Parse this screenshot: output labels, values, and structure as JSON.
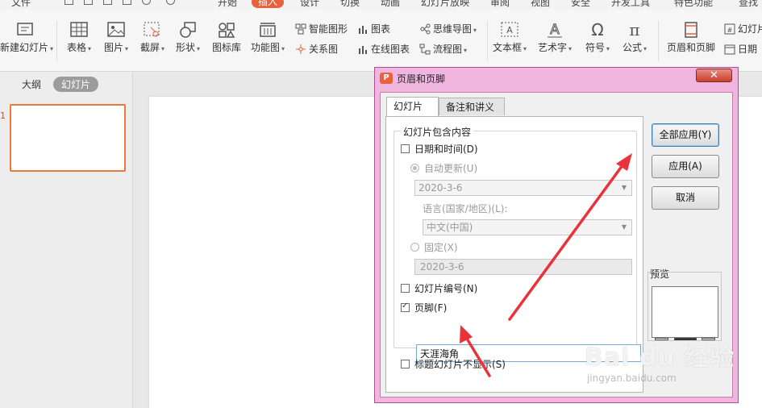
{
  "menubar": {
    "items": [
      "文件",
      "开始",
      "插入",
      "设计",
      "切换",
      "动画",
      "幻灯片放映",
      "审阅",
      "视图",
      "安全",
      "开发工具",
      "特色功能",
      "查找"
    ],
    "active": "插入"
  },
  "ribbon": {
    "new_slide": "新建幻灯片",
    "table": "表格",
    "picture": "图片",
    "screenshot": "截屏",
    "shape": "形状",
    "icon_lib": "图标库",
    "func_chart": "功能图",
    "smart_art": "智能图形",
    "relation": "关系图",
    "chart": "图表",
    "online_chart": "在线图表",
    "mind_map": "思维导图",
    "flow_chart": "流程图",
    "textbox": "文本框",
    "art_text": "艺术字",
    "symbol": "符号",
    "formula": "公式",
    "header_footer": "页眉和页脚",
    "slide_num": "幻灯片",
    "date": "日期"
  },
  "leftpanel": {
    "tab_outline": "大纲",
    "tab_slides": "幻灯片",
    "slide_number": "1"
  },
  "dialog": {
    "title": "页眉和页脚",
    "close": "✕",
    "tabs": [
      "幻灯片",
      "备注和讲义"
    ],
    "group_label": "幻灯片包含内容",
    "date_time_label": "日期和时间(D)",
    "date_time_checked": false,
    "auto_update_label": "自动更新(U)",
    "auto_update_value": "2020-3-6",
    "language_label": "语言(国家/地区)(L):",
    "language_value": "中文(中国)",
    "fixed_label": "固定(X)",
    "fixed_value": "2020-3-6",
    "slide_number_label": "幻灯片编号(N)",
    "slide_number_checked": false,
    "footer_label": "页脚(F)",
    "footer_checked": true,
    "footer_value": "天涯海角",
    "title_slide_hide_label": "标题幻灯片不显示(S)",
    "title_slide_hide_checked": false,
    "btn_apply_all": "全部应用(Y)",
    "btn_apply": "应用(A)",
    "btn_cancel": "取消",
    "preview_label": "预览"
  },
  "watermark": {
    "logo": "Bai du 经验",
    "url": "jingyan.baidu.com"
  },
  "colors": {
    "accent": "#e8603c",
    "dialog_frame": "#f0b6e0",
    "arrow": "#e8333a"
  }
}
